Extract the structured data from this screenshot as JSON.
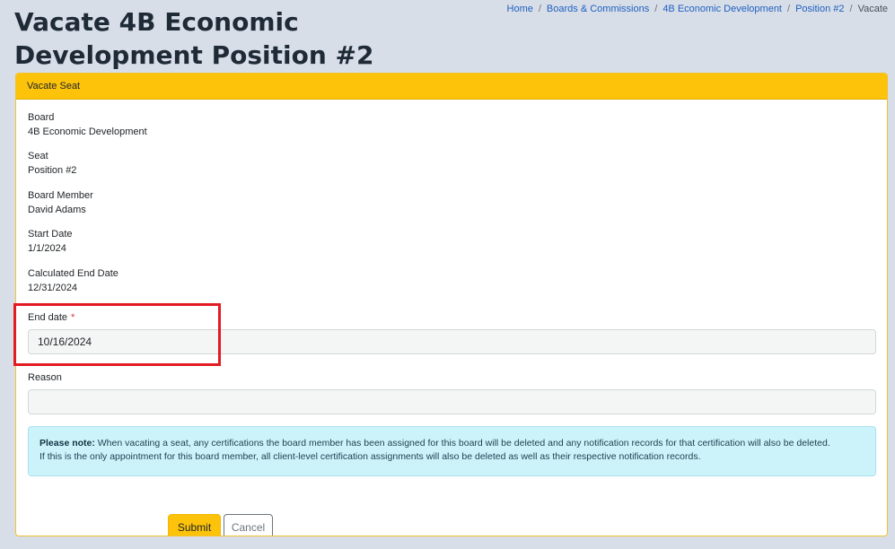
{
  "page": {
    "title": "Vacate 4B Economic Development Position #2"
  },
  "breadcrumb": {
    "items": [
      {
        "label": "Home"
      },
      {
        "label": "Boards & Commissions"
      },
      {
        "label": "4B Economic Development"
      },
      {
        "label": "Position #2"
      }
    ],
    "current": "Vacate",
    "separator": "/"
  },
  "card": {
    "header": "Vacate Seat",
    "fields": {
      "board": {
        "label": "Board",
        "value": "4B Economic Development"
      },
      "seat": {
        "label": "Seat",
        "value": "Position #2"
      },
      "member": {
        "label": "Board Member",
        "value": "David Adams"
      },
      "start": {
        "label": "Start Date",
        "value": "1/1/2024"
      },
      "calc_end": {
        "label": "Calculated End Date",
        "value": "12/31/2024"
      }
    },
    "end_date": {
      "label": "End date",
      "required_mark": "*",
      "value": "10/16/2024"
    },
    "reason": {
      "label": "Reason",
      "value": ""
    },
    "note": {
      "bold": "Please note:",
      "line1": " When vacating a seat, any certifications the board member has been assigned for this board will be deleted and any notification records for that certification will also be deleted.",
      "line2": "If this is the only appointment for this board member, all client-level certification assignments will also be deleted as well as their respective notification records."
    },
    "buttons": {
      "submit": "Submit",
      "cancel": "Cancel"
    }
  },
  "colors": {
    "accent": "#fcc30a",
    "highlight": "#e21b23",
    "note_bg": "#cdf3fa"
  }
}
